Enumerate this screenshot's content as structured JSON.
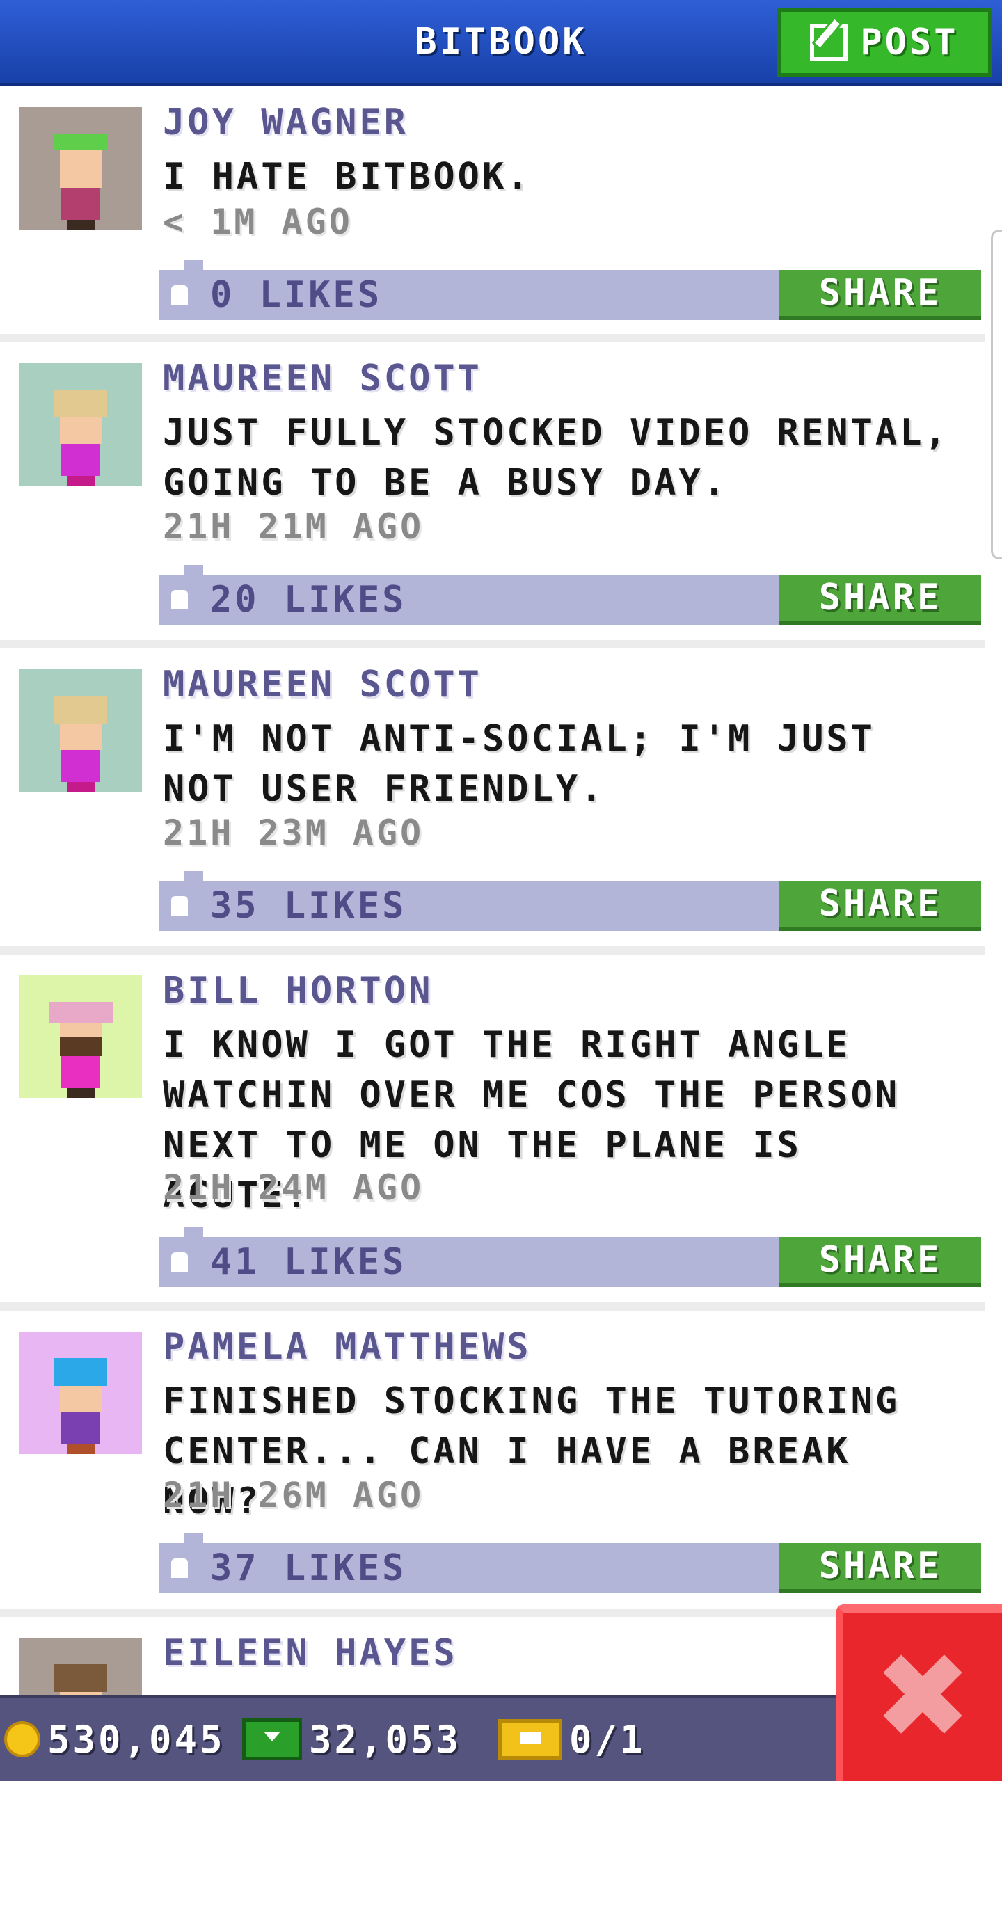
{
  "header": {
    "title": "BITBOOK",
    "post_label": "POST"
  },
  "posts": [
    {
      "name": "JOY WAGNER",
      "message": "I HATE BITBOOK.",
      "time": "< 1M AGO",
      "likes": "0 LIKES",
      "share": "SHARE",
      "avatar": {
        "bg": "#a89c94",
        "hair": "#5fce4a",
        "shirt": "#b23f6e"
      }
    },
    {
      "name": "MAUREEN SCOTT",
      "message": "JUST FULLY STOCKED VIDEO RENTAL, GOING TO BE A BUSY DAY.",
      "time": "21H 21M AGO",
      "likes": "20 LIKES",
      "share": "SHARE",
      "avatar": {
        "bg": "#a8cfc0",
        "hair": "#e2c98f",
        "shirt": "#d22fd2"
      }
    },
    {
      "name": "MAUREEN SCOTT",
      "message": "I'M NOT ANTI-SOCIAL; I'M JUST NOT USER FRIENDLY.",
      "time": "21H 23M AGO",
      "likes": "35 LIKES",
      "share": "SHARE",
      "avatar": {
        "bg": "#a8cfc0",
        "hair": "#e2c98f",
        "shirt": "#d22fd2"
      }
    },
    {
      "name": "BILL HORTON",
      "message": "I KNOW I GOT THE RIGHT ANGLE WATCHIN OVER ME COS THE PERSON NEXT TO ME ON THE PLANE IS ACUTE!",
      "time": "21H 24M AGO",
      "likes": "41 LIKES",
      "share": "SHARE",
      "avatar": {
        "bg": "#dcf5a8",
        "hair": "#e8a8c8",
        "shirt": "#e82fc2"
      }
    },
    {
      "name": "PAMELA MATTHEWS",
      "message": "FINISHED STOCKING THE TUTORING CENTER... CAN I HAVE A BREAK NOW?",
      "time": "21H 26M AGO",
      "likes": "37 LIKES",
      "share": "SHARE",
      "avatar": {
        "bg": "#e8b6f2",
        "hair": "#2aa8e8",
        "shirt": "#7a3fb0"
      }
    },
    {
      "name": "EILEEN HAYES",
      "message": "",
      "time": "",
      "likes": "",
      "share": "",
      "avatar": {
        "bg": "#a89c94",
        "hair": "#7a5a3a",
        "shirt": "#8a6a4a"
      }
    }
  ],
  "status": {
    "coins": "530,045",
    "bux": "32,053",
    "tickets": "0/1"
  },
  "icons": {
    "post": "edit-icon",
    "like": "thumbs-up-icon",
    "coin": "coin-icon",
    "bux": "bux-icon",
    "ticket": "ticket-icon",
    "close": "close-icon"
  },
  "colors": {
    "header": "#2a55c8",
    "post_button": "#36b82b",
    "share_button": "#4ea63a",
    "likes_bar": "#b3b5d8",
    "name": "#5a568f",
    "bottom_bar": "#54547e",
    "close_button": "#e8262c"
  }
}
